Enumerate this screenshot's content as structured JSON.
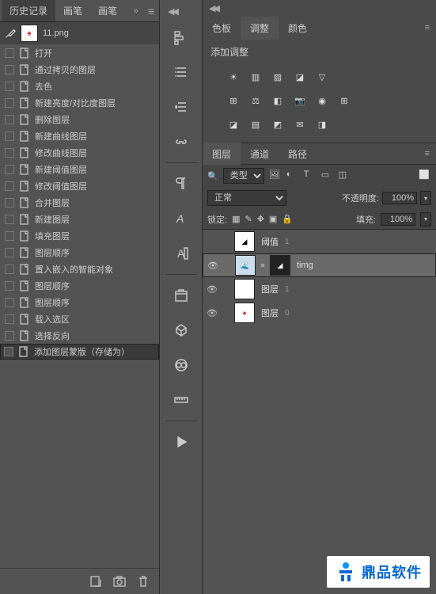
{
  "left_panel": {
    "tabs": [
      "历史记录",
      "画笔",
      "画笔"
    ],
    "active_tab": 0,
    "document_name": "11.png",
    "history": [
      "打开",
      "通过拷贝的图层",
      "去色",
      "新建亮度/对比度图层",
      "删除图层",
      "新建曲线图层",
      "修改曲线图层",
      "新建阈值图层",
      "修改阈值图层",
      "合并图层",
      "新建图层",
      "填充图层",
      "图层顺序",
      "置入嵌入的智能对象",
      "图层顺序",
      "图层顺序",
      "载入选区",
      "选择反向",
      "添加图层蒙版（存储为）"
    ],
    "selected_history": 18
  },
  "right_panel": {
    "top_tabs": [
      "色板",
      "调整",
      "颜色"
    ],
    "top_active": 1,
    "adjust_title": "添加调整",
    "layer_tabs": [
      "图层",
      "通道",
      "路径"
    ],
    "layer_active": 0,
    "filter_label": "类型",
    "blend_mode": "正常",
    "opacity_label": "不透明度:",
    "opacity_value": "100%",
    "lock_label": "锁定:",
    "fill_label": "填充:",
    "fill_value": "100%",
    "layers": [
      {
        "name": "阈值",
        "ext": "1",
        "thumb": "bw",
        "visible": false,
        "selected": false,
        "mask": false
      },
      {
        "name": "timg",
        "ext": "",
        "thumb": "img",
        "visible": true,
        "selected": true,
        "mask": true
      },
      {
        "name": "图层",
        "ext": "1",
        "thumb": "white",
        "visible": true,
        "selected": false,
        "mask": false
      },
      {
        "name": "图层",
        "ext": "0",
        "thumb": "img2",
        "visible": true,
        "selected": false,
        "mask": false
      }
    ]
  },
  "logo": {
    "text": "鼎品软件"
  }
}
